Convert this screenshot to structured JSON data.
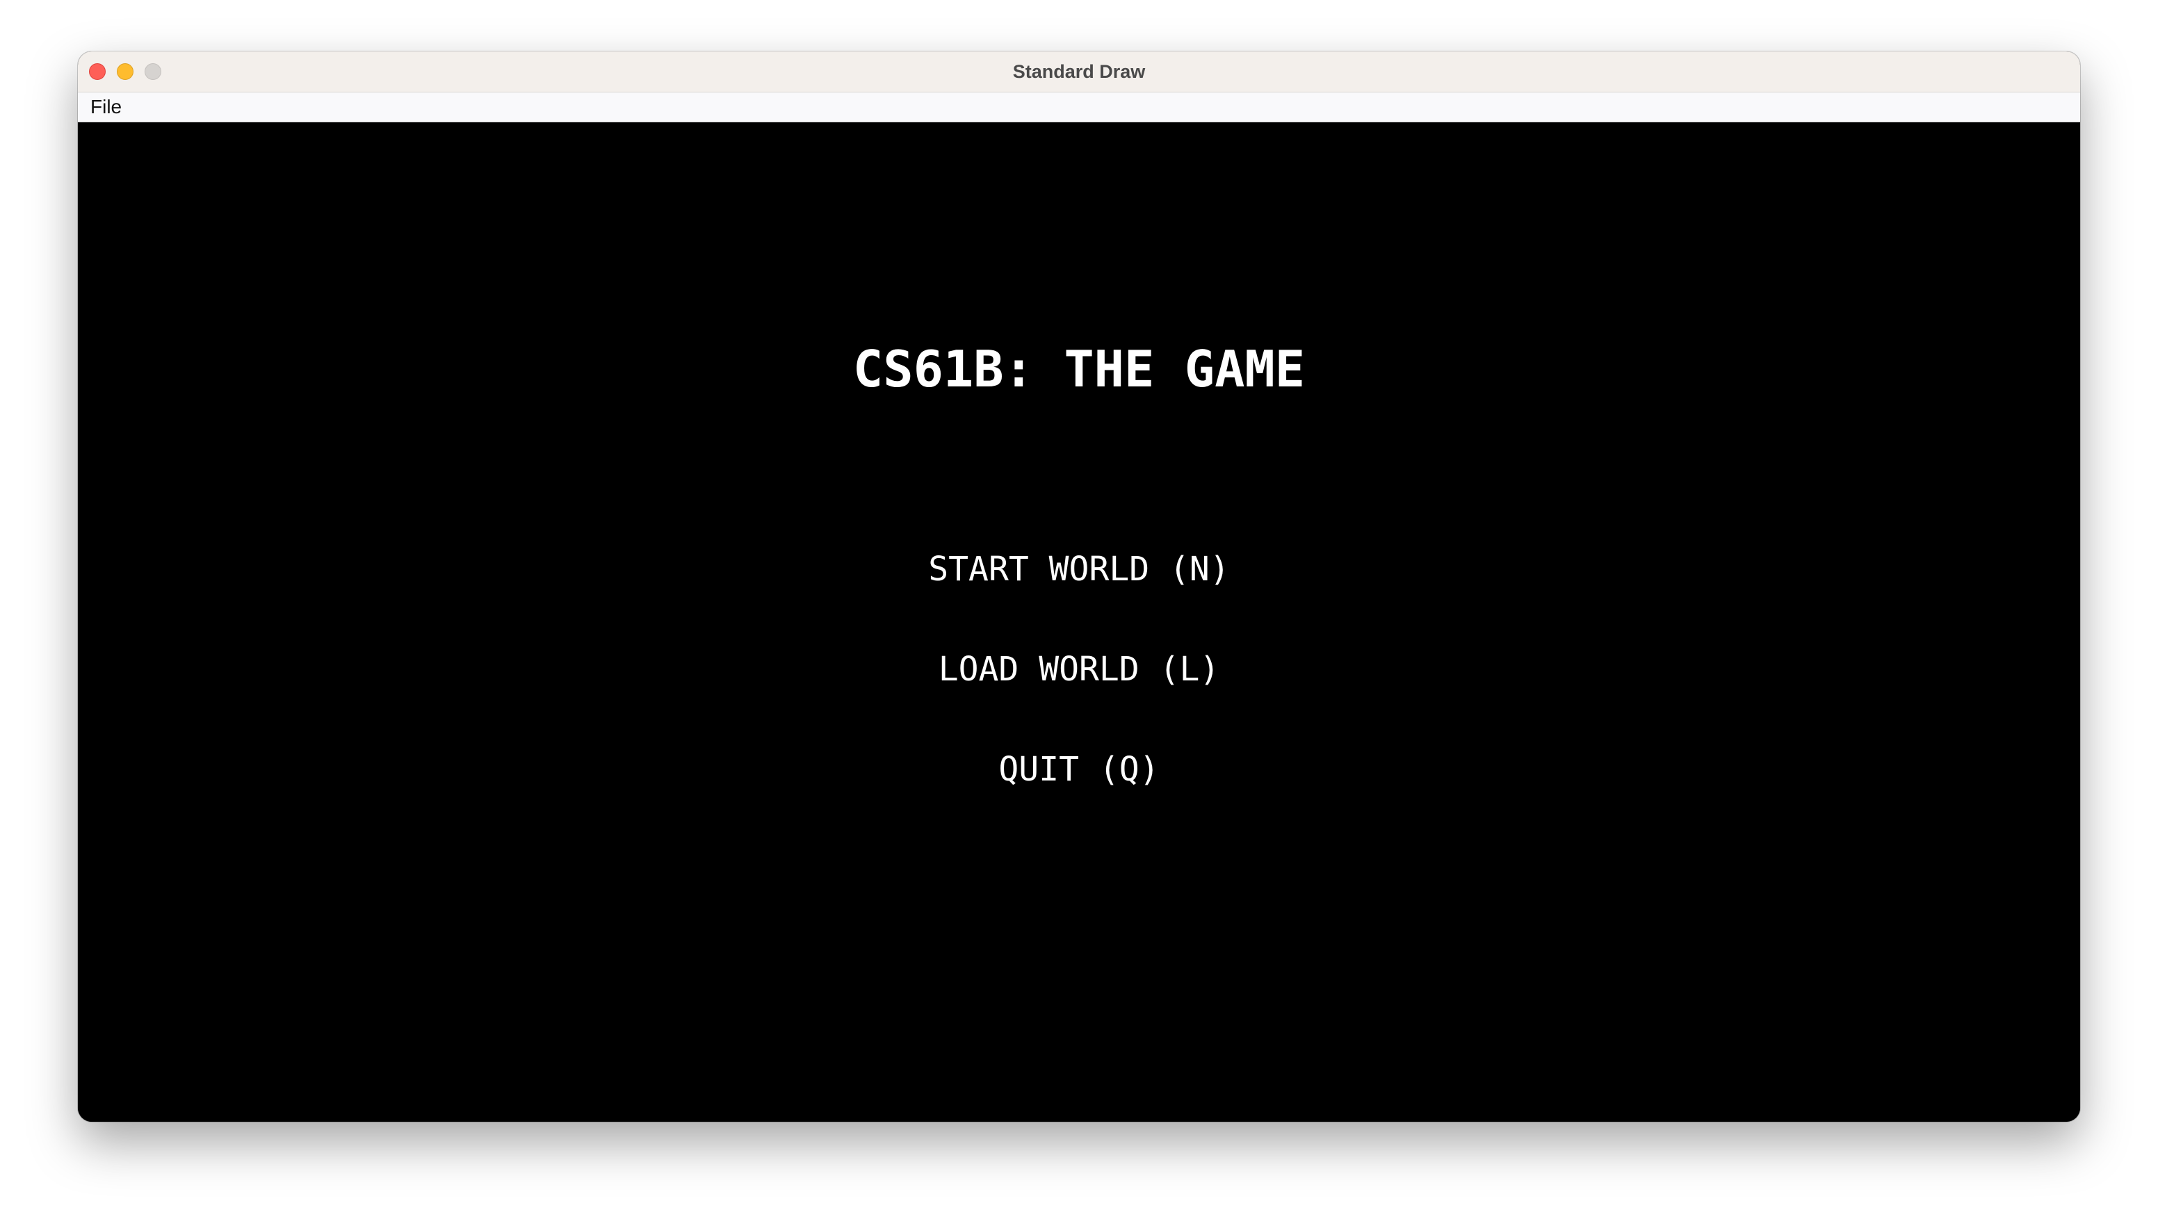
{
  "window": {
    "title": "Standard Draw"
  },
  "menubar": {
    "items": [
      {
        "label": "File"
      }
    ]
  },
  "game": {
    "title": "CS61B: THE GAME",
    "options": [
      {
        "label": "START WORLD (N)"
      },
      {
        "label": "LOAD WORLD (L)"
      },
      {
        "label": "QUIT (Q)"
      }
    ]
  },
  "colors": {
    "canvas_background": "#000000",
    "text": "#ffffff",
    "close_button": "#fe5f57",
    "minimize_button": "#febc2e",
    "zoom_button": "#d6d3d0"
  }
}
